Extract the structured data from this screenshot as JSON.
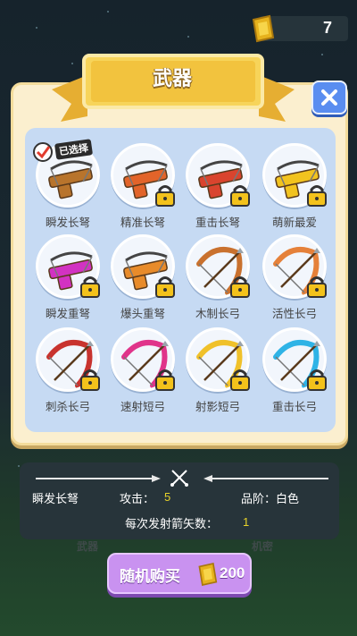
{
  "currency": {
    "coins": "7"
  },
  "panel": {
    "title": "武器"
  },
  "weapons": [
    {
      "label": "瞬发长弩",
      "selected": true,
      "locked": false,
      "color": "#b8742c",
      "type": "crossbow"
    },
    {
      "label": "精准长弩",
      "selected": false,
      "locked": true,
      "color": "#e2642a",
      "type": "crossbow"
    },
    {
      "label": "重击长弩",
      "selected": false,
      "locked": true,
      "color": "#d9442e",
      "type": "crossbow"
    },
    {
      "label": "萌新最爱",
      "selected": false,
      "locked": true,
      "color": "#f2c31f",
      "type": "crossbow"
    },
    {
      "label": "瞬发重弩",
      "selected": false,
      "locked": true,
      "color": "#d232c2",
      "type": "crossbow"
    },
    {
      "label": "爆头重弩",
      "selected": false,
      "locked": true,
      "color": "#e88b2a",
      "type": "crossbow"
    },
    {
      "label": "木制长弓",
      "selected": false,
      "locked": true,
      "color": "#c9712e",
      "type": "bow"
    },
    {
      "label": "活性长弓",
      "selected": false,
      "locked": true,
      "color": "#e5813a",
      "type": "bow"
    },
    {
      "label": "刺杀长弓",
      "selected": false,
      "locked": true,
      "color": "#c8332e",
      "type": "bow"
    },
    {
      "label": "速射短弓",
      "selected": false,
      "locked": true,
      "color": "#e0348a",
      "type": "bow"
    },
    {
      "label": "射影短弓",
      "selected": false,
      "locked": true,
      "color": "#f0c12a",
      "type": "bow"
    },
    {
      "label": "重击长弓",
      "selected": false,
      "locked": true,
      "color": "#2fb3e6",
      "type": "bow"
    }
  ],
  "selected_tag": "已选择",
  "info": {
    "name": "瞬发长弩",
    "attack_label": "攻击：",
    "attack_value": "5",
    "grade_label": "品阶：白色",
    "arrows_label": "每次发射箭矢数：",
    "arrows_value": "1"
  },
  "background_tabs": {
    "left": "武器",
    "right": "机密"
  },
  "buy": {
    "label": "随机购买",
    "price": "200"
  },
  "colors": {
    "panel": "#fbefcf",
    "grid": "#c6daf3",
    "accent": "#5a8df0",
    "buy": "#c992f0",
    "ribbon": "#f6cc4f"
  },
  "icons": {
    "coin": "coin-icon",
    "close": "close-icon",
    "lock": "lock-icon",
    "check": "check-icon",
    "crossed-swords": "crossed-swords-icon"
  }
}
